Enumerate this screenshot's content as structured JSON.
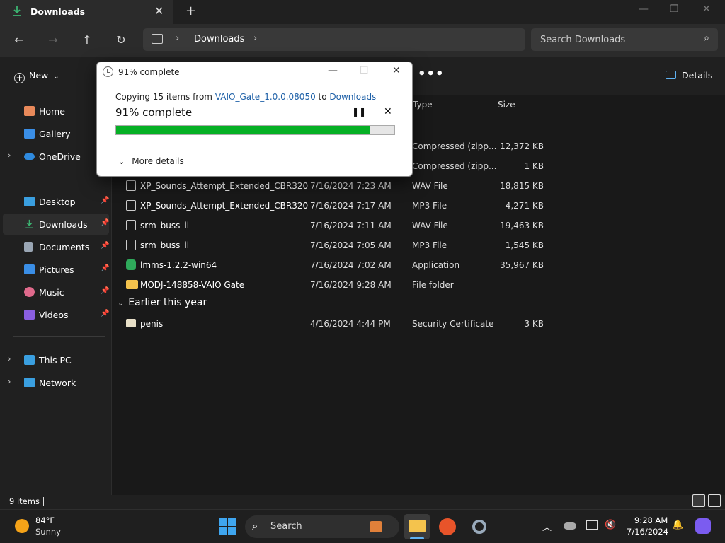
{
  "window": {
    "tab_title": "Downloads",
    "tab_close": "✕",
    "new_tab": "+",
    "minimize": "—",
    "maximize": "❐",
    "close": "✕"
  },
  "navigation": {
    "back": "←",
    "forward": "→",
    "up": "↑",
    "refresh": "↻",
    "breadcrumb": "Downloads",
    "search_placeholder": "Search Downloads"
  },
  "toolbar": {
    "new_label": "New",
    "new_caret": "⌄",
    "more": "•••",
    "details_label": "Details"
  },
  "sidebar": {
    "items": [
      {
        "label": "Home",
        "icon": "home-icon",
        "color": "#e8895a"
      },
      {
        "label": "Gallery",
        "icon": "gallery-icon",
        "color": "#3a8ee6"
      },
      {
        "label": "OneDrive",
        "icon": "onedrive-icon",
        "color": "#2f8be0",
        "expandable": true
      },
      {
        "label": "Desktop",
        "icon": "desktop-icon",
        "color": "#3a9fe0",
        "pinned": true
      },
      {
        "label": "Downloads",
        "icon": "downloads-icon",
        "color": "#3cb371",
        "pinned": true,
        "selected": true
      },
      {
        "label": "Documents",
        "icon": "documents-icon",
        "color": "#9aa6b4",
        "pinned": true
      },
      {
        "label": "Pictures",
        "icon": "pictures-icon",
        "color": "#3a8ee6",
        "pinned": true
      },
      {
        "label": "Music",
        "icon": "music-icon",
        "color": "#e06a8c",
        "pinned": true
      },
      {
        "label": "Videos",
        "icon": "videos-icon",
        "color": "#8a5ee0",
        "pinned": true
      },
      {
        "label": "This PC",
        "icon": "this-pc-icon",
        "color": "#3a9fe0",
        "expandable": true
      },
      {
        "label": "Network",
        "icon": "network-icon",
        "color": "#3a9fe0",
        "expandable": true
      }
    ]
  },
  "columns": {
    "type": "Type",
    "size": "Size"
  },
  "files": [
    {
      "name": "",
      "date": "",
      "type": "Compressed (zipp...",
      "size": "12,372 KB",
      "icon": "zip-icon"
    },
    {
      "name": "",
      "date": "",
      "type": "Compressed (zipp...",
      "size": "1 KB",
      "icon": "zip-icon"
    },
    {
      "name": "XP_Sounds_Attempt_Extended_CBR320",
      "date": "7/16/2024 7:23 AM",
      "type": "WAV File",
      "size": "18,815 KB",
      "icon": "audio-file-icon"
    },
    {
      "name": "XP_Sounds_Attempt_Extended_CBR320",
      "date": "7/16/2024 7:17 AM",
      "type": "MP3 File",
      "size": "4,271 KB",
      "icon": "audio-file-icon"
    },
    {
      "name": "srm_buss_ii",
      "date": "7/16/2024 7:11 AM",
      "type": "WAV File",
      "size": "19,463 KB",
      "icon": "audio-file-icon"
    },
    {
      "name": "srm_buss_ii",
      "date": "7/16/2024 7:05 AM",
      "type": "MP3 File",
      "size": "1,545 KB",
      "icon": "audio-file-icon"
    },
    {
      "name": "lmms-1.2.2-win64",
      "date": "7/16/2024 7:02 AM",
      "type": "Application",
      "size": "35,967 KB",
      "icon": "application-icon"
    },
    {
      "name": "MODJ-148858-VAIO Gate",
      "date": "7/16/2024 9:28 AM",
      "type": "File folder",
      "size": "",
      "icon": "folder-icon"
    }
  ],
  "group_earlier": {
    "label": "Earlier this year",
    "files": [
      {
        "name": "penis",
        "date": "4/16/2024 4:44 PM",
        "type": "Security Certificate",
        "size": "3 KB",
        "icon": "certificate-icon"
      }
    ]
  },
  "status": {
    "count": "9 items"
  },
  "dialog": {
    "title": "91% complete",
    "copy_prefix": "Copying 15 items from ",
    "source": "VAIO_Gate_1.0.0.08050",
    "to": " to ",
    "destination": "Downloads",
    "percent_label": "91% complete",
    "progress": 0.91,
    "pause": "❚❚",
    "cancel": "✕",
    "more_details": "More details",
    "more_caret": "⌄",
    "minimize": "—",
    "maximize": "☐",
    "close": "✕",
    "progress_color": "#06b025"
  },
  "taskbar": {
    "weather_temp": "84°F",
    "weather_desc": "Sunny",
    "search_label": "Search",
    "clock_time": "9:28 AM",
    "clock_date": "7/16/2024"
  }
}
